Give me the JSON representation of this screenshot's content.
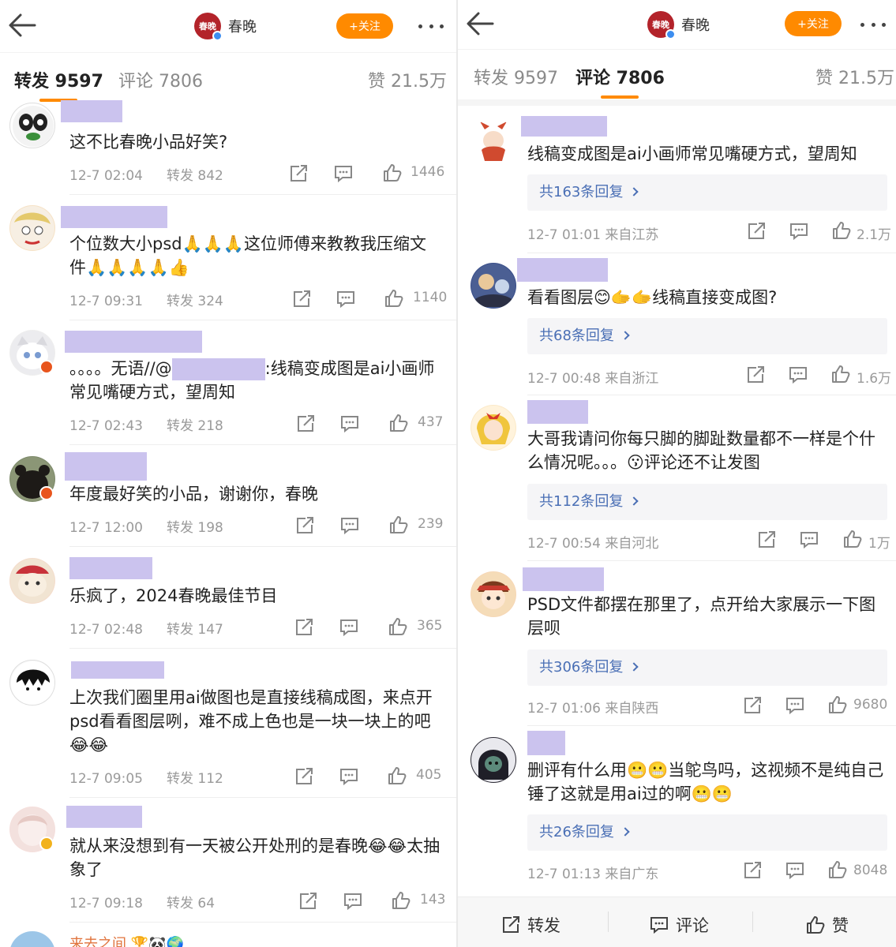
{
  "header": {
    "account": "春晚",
    "logo_text": "春晚",
    "follow": "+关注"
  },
  "tabs": {
    "repost": "转发 9597",
    "comment": "评论 7806",
    "likes": "赞 21.5万"
  },
  "left_items": [
    {
      "text": "这不比春晚小品好笑?",
      "time": "12-7 02:04",
      "repost": "转发 842",
      "likes": "1446"
    },
    {
      "text": "个位数大小psd🙏🙏🙏这位师傅来教教我压缩文件🙏🙏🙏🙏👍",
      "time": "12-7 09:31",
      "repost": "转发 324",
      "likes": "1140"
    },
    {
      "text_a": "。。。。无语//@",
      "text_b": ":线稿变成图是ai小画师常见嘴硬方式，望周知",
      "time": "12-7 02:43",
      "repost": "转发 218",
      "likes": "437"
    },
    {
      "text": "年度最好笑的小品，谢谢你，春晚",
      "time": "12-7 12:00",
      "repost": "转发 198",
      "likes": "239"
    },
    {
      "text": "乐疯了，2024春晚最佳节目",
      "time": "12-7 02:48",
      "repost": "转发 147",
      "likes": "365"
    },
    {
      "text": "上次我们圈里用ai做图也是直接线稿成图，来点开psd看看图层咧，难不成上色也是一块一块上的吧😂😂",
      "time": "12-7 09:05",
      "repost": "转发 112",
      "likes": "405"
    },
    {
      "text": "就从来没想到有一天被公开处刑的是春晚😂😂太抽象了",
      "time": "12-7 09:18",
      "repost": "转发 64",
      "likes": "143"
    }
  ],
  "left_partial_name": "来去之间 🏆🐼🌍",
  "right_items": [
    {
      "text": "线稿变成图是ai小画师常见嘴硬方式，望周知",
      "reply": "共163条回复",
      "time": "12-7 01:01",
      "from": "来自江苏",
      "likes": "2.1万"
    },
    {
      "text": "看看图层😊🫱🫱线稿直接变成图?",
      "reply": "共68条回复",
      "time": "12-7 00:48",
      "from": "来自浙江",
      "likes": "1.6万"
    },
    {
      "text": "大哥我请问你每只脚的脚趾数量都不一样是个什么情况呢。。。😗评论还不让发图",
      "reply": "共112条回复",
      "time": "12-7 00:54",
      "from": "来自河北",
      "likes": "1万"
    },
    {
      "text": "PSD文件都摆在那里了，点开给大家展示一下图层呗",
      "reply": "共306条回复",
      "time": "12-7 01:06",
      "from": "来自陕西",
      "likes": "9680"
    },
    {
      "text": "删评有什么用😬😬当鸵鸟吗，这视频不是纯自己锤了这就是用ai过的啊😬😬",
      "reply": "共26条回复",
      "time": "12-7 01:13",
      "from": "来自广东",
      "likes": "8048"
    }
  ],
  "bottom": {
    "repost": "转发",
    "comment": "评论",
    "like": "赞"
  },
  "colors": {
    "accent": "#ff8a00",
    "link": "#4a6fb5",
    "redacted": "#cbc3ee"
  }
}
